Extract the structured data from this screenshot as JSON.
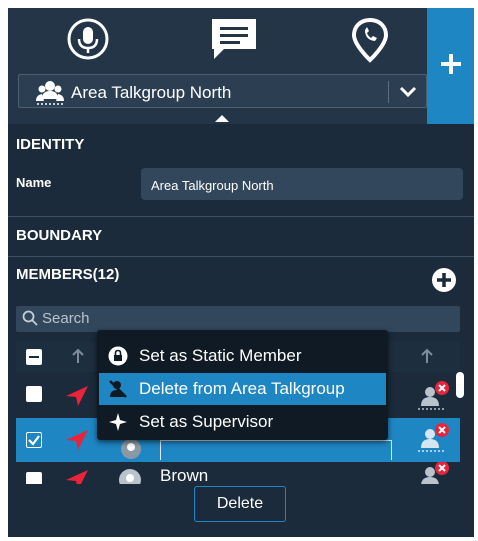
{
  "talkgroup": {
    "selected": "Area Talkgroup North"
  },
  "identity": {
    "title": "IDENTITY",
    "name_label": "Name",
    "name_value": "Area Talkgroup North"
  },
  "boundary": {
    "title": "BOUNDARY"
  },
  "members": {
    "title": "MEMBERS(12)",
    "search_placeholder": "Search",
    "rows": [
      {
        "name": "",
        "checked": false
      },
      {
        "name": "",
        "checked": true
      },
      {
        "name": "Brown",
        "checked": false
      }
    ]
  },
  "context_menu": {
    "items": [
      {
        "label": "Set as Static Member",
        "icon": "lock-icon"
      },
      {
        "label": "Delete from Area Talkgroup",
        "icon": "remove-user-icon"
      },
      {
        "label": "Set as Supervisor",
        "icon": "supervisor-star-icon"
      }
    ]
  },
  "footer": {
    "delete_label": "Delete"
  },
  "colors": {
    "accent": "#1f86c4",
    "panel": "#1b2b3b",
    "badge": "#e8233a",
    "map_marker": "#e8233a"
  }
}
